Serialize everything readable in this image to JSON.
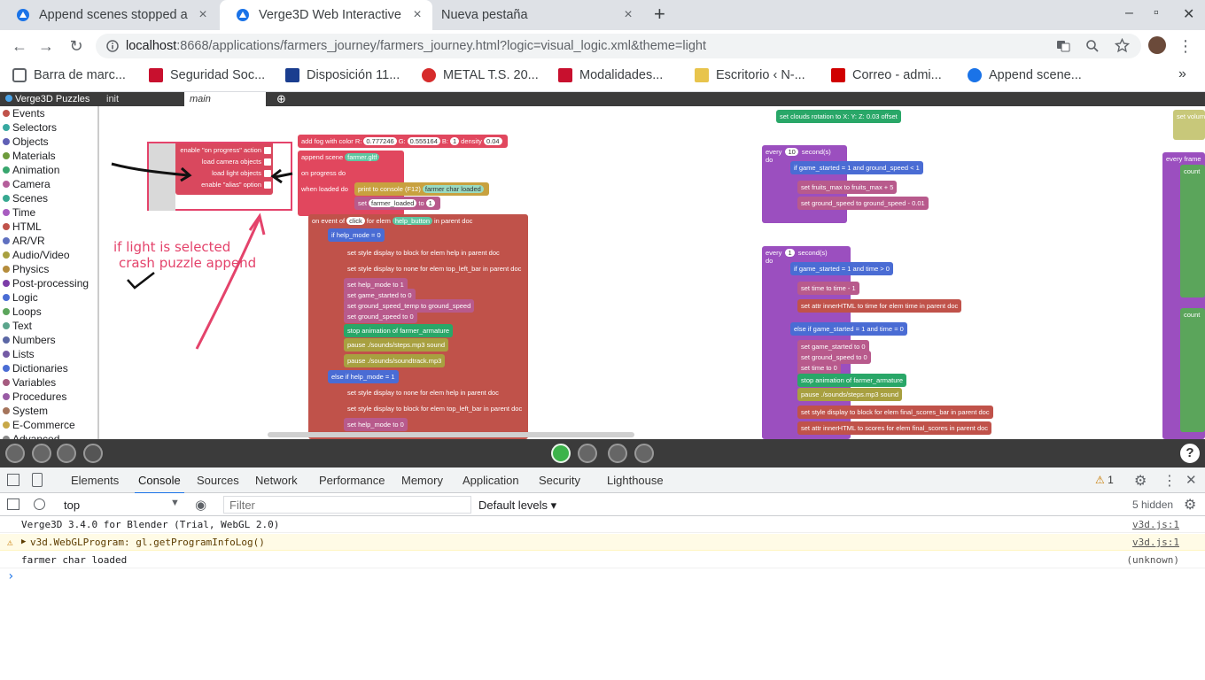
{
  "tabs": [
    {
      "title": "Append scenes stopped a",
      "close": "×"
    },
    {
      "title": "Verge3D Web Interactive",
      "close": "×"
    },
    {
      "title": "Nueva pestaña",
      "close": "×"
    }
  ],
  "new_tab": "+",
  "window_controls": {
    "minimize": "–",
    "restore": "▫",
    "close": "✕"
  },
  "address": {
    "host": "localhost",
    "rest": ":8668/applications/farmers_journey/farmers_journey.html?logic=visual_logic.xml&theme=light"
  },
  "bookmarks": [
    {
      "label": "Barra de marc...",
      "color": "#5f6368"
    },
    {
      "label": "Seguridad Soc...",
      "color": "#c8102e"
    },
    {
      "label": "Disposición 11...",
      "color": "#1a3d8f"
    },
    {
      "label": "METAL T.S. 20...",
      "color": "#d62b2b"
    },
    {
      "label": "Modalidades...",
      "color": "#c8102e"
    },
    {
      "label": "Escritorio ‹ N-...",
      "color": "#e8c44c"
    },
    {
      "label": "Correo - admi...",
      "color": "#d00000"
    },
    {
      "label": "Append scene...",
      "color": "#1a73e8"
    }
  ],
  "bookmarks_more": "»",
  "puzzles": {
    "brand": "Verge3D Puzzles",
    "tabs": [
      "init",
      "main"
    ],
    "categories": [
      {
        "label": "Events",
        "color": "#c0524a"
      },
      {
        "label": "Selectors",
        "color": "#37a8a0"
      },
      {
        "label": "Objects",
        "color": "#5f5fb5"
      },
      {
        "label": "Materials",
        "color": "#6d9b3c"
      },
      {
        "label": "Animation",
        "color": "#38a66e"
      },
      {
        "label": "Camera",
        "color": "#b55f9b"
      },
      {
        "label": "Scenes",
        "color": "#36a890"
      },
      {
        "label": "Time",
        "color": "#a85cc0"
      },
      {
        "label": "HTML",
        "color": "#c0524a"
      },
      {
        "label": "AR/VR",
        "color": "#5f70c0"
      },
      {
        "label": "Audio/Video",
        "color": "#a8a040"
      },
      {
        "label": "Physics",
        "color": "#b58c3c"
      },
      {
        "label": "Post-processing",
        "color": "#7c3ca8"
      },
      {
        "label": "Logic",
        "color": "#4a6cd4"
      },
      {
        "label": "Loops",
        "color": "#5ba55b"
      },
      {
        "label": "Text",
        "color": "#5ba58c"
      },
      {
        "label": "Numbers",
        "color": "#5b67a5"
      },
      {
        "label": "Lists",
        "color": "#745ba5"
      },
      {
        "label": "Dictionaries",
        "color": "#4a6cd4"
      },
      {
        "label": "Variables",
        "color": "#a55b80"
      },
      {
        "label": "Procedures",
        "color": "#995ba5"
      },
      {
        "label": "System",
        "color": "#a5745b"
      },
      {
        "label": "E-Commerce",
        "color": "#c8a848"
      },
      {
        "label": "Advanced",
        "color": "#888888"
      }
    ]
  },
  "append_options": [
    "enable \"on progress\" action",
    "load camera objects",
    "load light objects",
    "enable \"alias\" option"
  ],
  "annotation": {
    "line1": "if light is selected",
    "line2": "crash puzzle append"
  },
  "blocks": {
    "fog": {
      "label": "add fog with color",
      "r": "R:",
      "rv": "0.777246",
      "g": "G:",
      "gv": "0.555164",
      "b": "B:",
      "bv": "1",
      "d": "density",
      "dv": "0.04"
    },
    "append": {
      "label": "append scene",
      "file": "farmer.gltf",
      "progress": "on progress do",
      "loaded": "when loaded do"
    },
    "console": {
      "label": "print to console (F12)",
      "msg": "farmer char loaded"
    },
    "set_loaded": {
      "label": "set",
      "var": "farmer_loaded",
      "to": "to",
      "val": "1"
    },
    "event": {
      "label": "on event of",
      "ev": "click",
      "elem": "for elem",
      "id": "help_button",
      "doc": "in parent doc"
    },
    "lines": [
      "if  help_mode  =  0",
      "set style  display  to  block  for elem  help  in parent doc",
      "set style  display  to  none  for elem  top_left_bar  in parent doc",
      "set  help_mode  to  1",
      "set  game_started  to  0",
      "set  ground_speed_temp  to  ground_speed",
      "set  ground_speed  to  0",
      "stop animation  of  farmer_armature",
      "pause  ./sounds/steps.mp3  sound",
      "pause  ./sounds/soundtrack.mp3",
      "else if  help_mode  =  1",
      "set style  display  to  none  for elem  help  in parent doc",
      "set style  display  to  block  for elem  top_left_bar  in parent doc",
      "set  help_mode  to  0"
    ],
    "clouds": "set  clouds  rotation  to  X:  Y:  Z:  0.03  offset",
    "every10": {
      "every": "every",
      "n": "10",
      "unit": "second(s)",
      "do": "do"
    },
    "right1": [
      "if  game_started  =  1  and  ground_speed  <  1",
      "set  fruits_max  to  fruits_max  +  5",
      "set  ground_speed  to  ground_speed  -  0.01"
    ],
    "every1": {
      "every": "every",
      "n": "1",
      "unit": "second(s)",
      "do": "do"
    },
    "right2": [
      "if  game_started  =  1  and  time  >  0",
      "set  time  to  time  -  1",
      "set attr  innerHTML  to  time  for elem  time  in parent doc",
      "else if  game_started  =  1  and  time  =  0",
      "set  game_started  to  0",
      "set  ground_speed  to  0",
      "set  time  to  0",
      "stop animation  of  farmer_armature",
      "pause  ./sounds/steps.mp3  sound",
      "set style  display  to  block  for elem  final_scores_bar  in parent doc",
      "set attr  innerHTML  to  scores  for elem  final_scores  in parent doc"
    ],
    "every_frame": "every frame",
    "count": "count",
    "set_volume": "set volum"
  },
  "devtools": {
    "tabs": [
      "Elements",
      "Console",
      "Sources",
      "Network",
      "Performance",
      "Memory",
      "Application",
      "Security",
      "Lighthouse"
    ],
    "warn_count": "1",
    "context": "top",
    "filter_placeholder": "Filter",
    "levels": "Default levels",
    "hidden": "5 hidden",
    "logs": [
      {
        "msg": "Verge3D 3.4.0 for Blender (Trial, WebGL 2.0)",
        "src": "v3d.js:1"
      },
      {
        "msg": "v3d.WebGLProgram: gl.getProgramInfoLog() ",
        "src": "v3d.js:1"
      },
      {
        "msg": "farmer char loaded",
        "src": "(unknown)"
      }
    ],
    "prompt": "›"
  }
}
